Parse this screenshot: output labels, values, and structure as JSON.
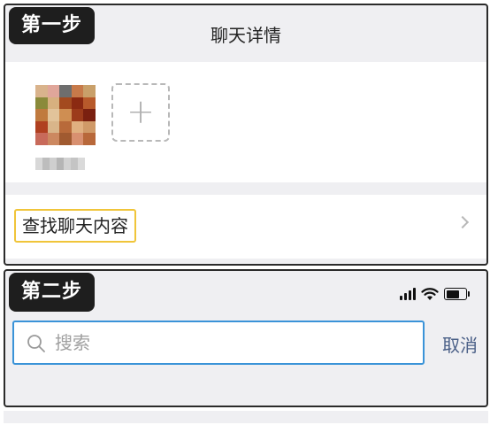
{
  "step1": {
    "badge": "第一步",
    "title": "聊天详情",
    "add_member_glyph": "+",
    "search_chat_label": "查找聊天内容",
    "chevron_icon": "chevron-right-icon"
  },
  "step2": {
    "badge": "第二步",
    "search_placeholder": "搜索",
    "cancel_label": "取消",
    "status_icons": [
      "signal-icon",
      "wifi-icon",
      "battery-icon"
    ]
  },
  "colors": {
    "badge_bg": "#1e1e1e",
    "highlight_border": "#f0c53a",
    "search_focus_border": "#3a93d8",
    "cancel_text": "#4a5f87",
    "page_gray": "#efeff2"
  }
}
